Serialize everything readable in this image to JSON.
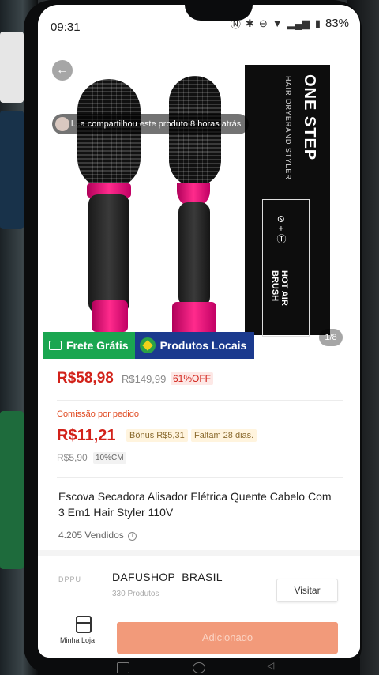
{
  "status_bar": {
    "time": "09:31",
    "battery": "83%"
  },
  "hero": {
    "share_text": "l...a compartilhou este produto 8 horas atrás",
    "image_counter": "1/8",
    "box_title": "ONE STEP",
    "box_subtitle": "HAIR DRYERAND STYLER",
    "box_brand": "HOT AIR BRUSH"
  },
  "badges": {
    "free_shipping": "Frete Grátis",
    "local_products": "Produtos Locais"
  },
  "pricing": {
    "price": "R$58,98",
    "old_price": "R$149,99",
    "discount": "61%OFF",
    "commission_label": "Comissão por pedido",
    "commission": "R$11,21",
    "bonus": "Bônus R$5,31",
    "days_left": "Faltam 28 dias.",
    "old_commission": "R$5,90",
    "commission_rate": "10%CM"
  },
  "product": {
    "title": "Escova Secadora Alisador Elétrica Quente Cabelo Com 3 Em1 Hair Styler 110V",
    "sold": "4.205 Vendidos"
  },
  "shop": {
    "logo_text": "DPPU",
    "name": "DAFUSHOP_BRASIL",
    "products": "330 Produtos",
    "visit_label": "Visitar"
  },
  "bottom_bar": {
    "store_label": "Minha Loja",
    "add_label": "Adicionado"
  },
  "colors": {
    "price_red": "#d2221a",
    "free_shipping_green": "#1aa650",
    "local_blue": "#1b3a8e",
    "add_button": "#f29a7a"
  }
}
